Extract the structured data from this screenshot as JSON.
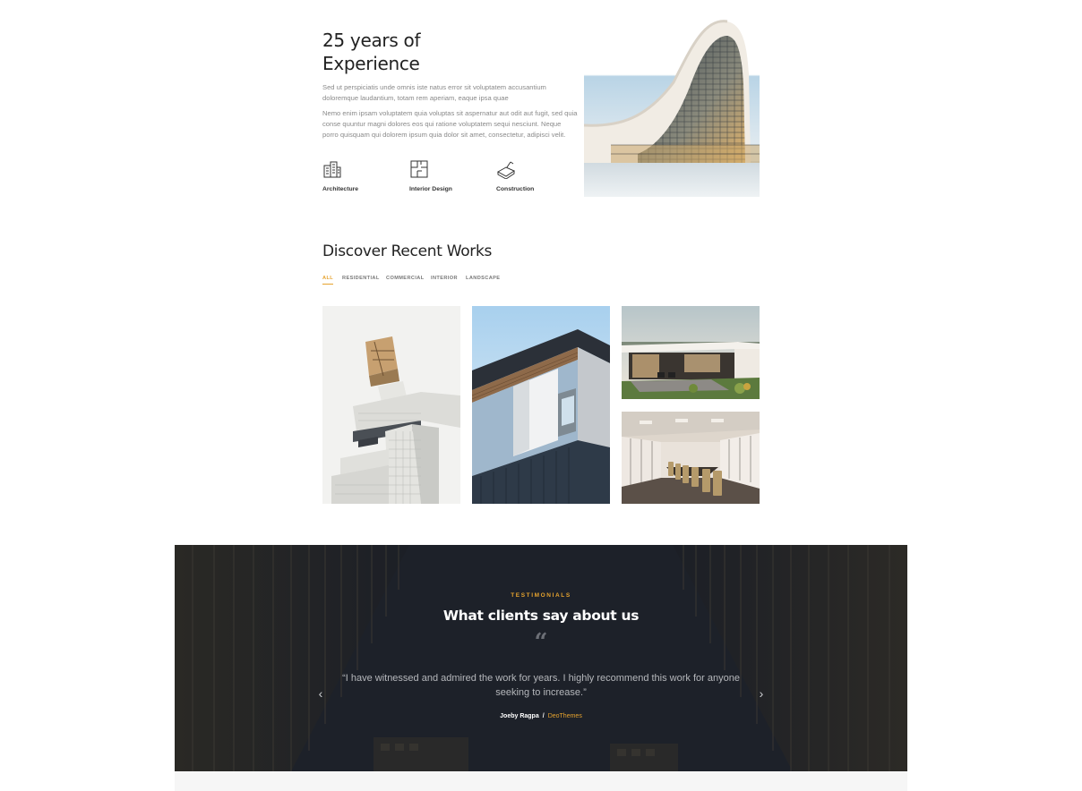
{
  "about": {
    "title_line1": "25 years of",
    "title_line2": "Experience",
    "paragraph1": "Sed ut perspiciatis unde omnis iste natus error sit voluptatem accusantium doloremque laudantium, totam rem aperiam, eaque ipsa quae",
    "paragraph2": "Nemo enim ipsam voluptatem quia voluptas sit aspernatur aut odit aut fugit, sed quia conse quuntur magni dolores eos qui ratione voluptatem sequi nesciunt. Neque porro quisquam qui dolorem ipsum quia dolor sit amet, consectetur, adipisci velit.",
    "services": [
      {
        "label": "Architecture",
        "icon": "buildings-icon"
      },
      {
        "label": "Interior Design",
        "icon": "floor-plan-icon"
      },
      {
        "label": "Construction",
        "icon": "trowel-brick-icon"
      }
    ]
  },
  "works": {
    "title": "Discover Recent Works",
    "filters": [
      "ALL",
      "RESIDENTIAL",
      "COMMERCIAL",
      "INTERIOR",
      "LANDSCAPE"
    ],
    "active_filter": "ALL"
  },
  "testimonials": {
    "kicker": "TESTIMONIALS",
    "title": "What clients say about us",
    "quote_mark": "“",
    "quote": "“I have witnessed and admired the work for years. I highly recommend this work for anyone seeking to increase.”",
    "author": "Joeby Ragpa",
    "separator": "/",
    "company": "DeoThemes",
    "prev": "‹",
    "next": "›"
  },
  "colors": {
    "accent": "#e6a32e",
    "dark_bg": "#1c1f26",
    "heading": "#222222",
    "body_text": "#8a8a8a"
  }
}
